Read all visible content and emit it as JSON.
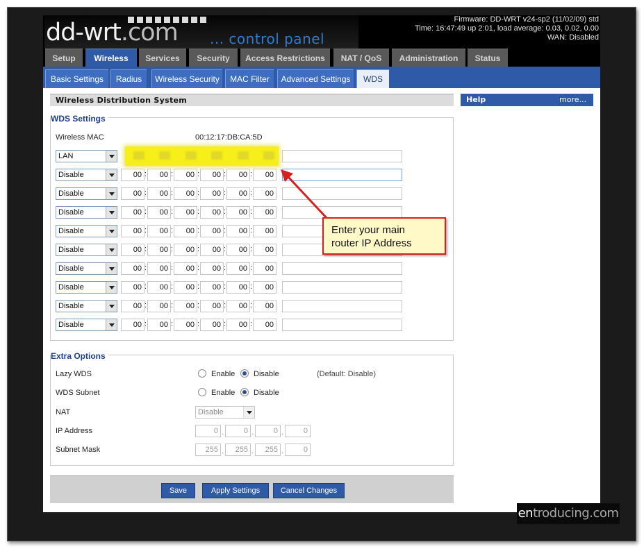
{
  "header": {
    "logo_text": "dd-wrt",
    "logo_dotcom": ".com",
    "logo_sub": "... control panel",
    "firmware": "Firmware: DD-WRT v24-sp2 (11/02/09) std",
    "time": "Time: 16:47:49 up 2:01, load average: 0.03, 0.02, 0.00",
    "wan": "WAN: Disabled"
  },
  "nav": {
    "tabs": [
      {
        "label": "Setup",
        "active": false
      },
      {
        "label": "Wireless",
        "active": true
      },
      {
        "label": "Services",
        "active": false
      },
      {
        "label": "Security",
        "active": false
      },
      {
        "label": "Access Restrictions",
        "active": false
      },
      {
        "label": "NAT / QoS",
        "active": false
      },
      {
        "label": "Administration",
        "active": false
      },
      {
        "label": "Status",
        "active": false
      }
    ]
  },
  "subnav": {
    "tabs": [
      {
        "label": "Basic Settings",
        "active": false
      },
      {
        "label": "Radius",
        "active": false
      },
      {
        "label": "Wireless Security",
        "active": false
      },
      {
        "label": "MAC Filter",
        "active": false
      },
      {
        "label": "Advanced Settings",
        "active": false
      },
      {
        "label": "WDS",
        "active": true
      }
    ]
  },
  "section_title": "Wireless Distribution System",
  "help": {
    "title": "Help",
    "more": "more..."
  },
  "wds": {
    "legend": "WDS Settings",
    "mac_label": "Wireless MAC",
    "mac_value": "00:12:17:DB:CA:5D",
    "rows": [
      {
        "mode": "LAN",
        "octets": [
          "",
          "",
          "",
          "",
          "",
          ""
        ],
        "highlighted": true
      },
      {
        "mode": "Disable",
        "octets": [
          "00",
          "00",
          "00",
          "00",
          "00",
          "00"
        ]
      },
      {
        "mode": "Disable",
        "octets": [
          "00",
          "00",
          "00",
          "00",
          "00",
          "00"
        ]
      },
      {
        "mode": "Disable",
        "octets": [
          "00",
          "00",
          "00",
          "00",
          "00",
          "00"
        ]
      },
      {
        "mode": "Disable",
        "octets": [
          "00",
          "00",
          "00",
          "00",
          "00",
          "00"
        ]
      },
      {
        "mode": "Disable",
        "octets": [
          "00",
          "00",
          "00",
          "00",
          "00",
          "00"
        ]
      },
      {
        "mode": "Disable",
        "octets": [
          "00",
          "00",
          "00",
          "00",
          "00",
          "00"
        ]
      },
      {
        "mode": "Disable",
        "octets": [
          "00",
          "00",
          "00",
          "00",
          "00",
          "00"
        ]
      },
      {
        "mode": "Disable",
        "octets": [
          "00",
          "00",
          "00",
          "00",
          "00",
          "00"
        ]
      },
      {
        "mode": "Disable",
        "octets": [
          "00",
          "00",
          "00",
          "00",
          "00",
          "00"
        ]
      }
    ]
  },
  "extra": {
    "legend": "Extra Options",
    "lazy_wds_label": "Lazy WDS",
    "wds_subnet_label": "WDS Subnet",
    "enable_label": "Enable",
    "disable_label": "Disable",
    "default_note": "(Default: Disable)",
    "nat_label": "NAT",
    "nat_value": "Disable",
    "ip_label": "IP Address",
    "ip_octets": [
      "0",
      "0",
      "0",
      "0"
    ],
    "mask_label": "Subnet Mask",
    "mask_octets": [
      "255",
      "255",
      "255",
      "0"
    ]
  },
  "buttons": {
    "save": "Save",
    "apply": "Apply Settings",
    "cancel": "Cancel Changes"
  },
  "annotation": {
    "line1": "Enter your main",
    "line2": "router IP Address",
    "highlight_color": "#f7ef1a",
    "callout_border": "#d61f1f"
  },
  "watermark": {
    "prefix": "en",
    "suffix": "troducing.com"
  },
  "colors": {
    "brand_blue": "#2f5aa8",
    "tab_gray": "#595959",
    "frame": "#1b1b1b"
  }
}
